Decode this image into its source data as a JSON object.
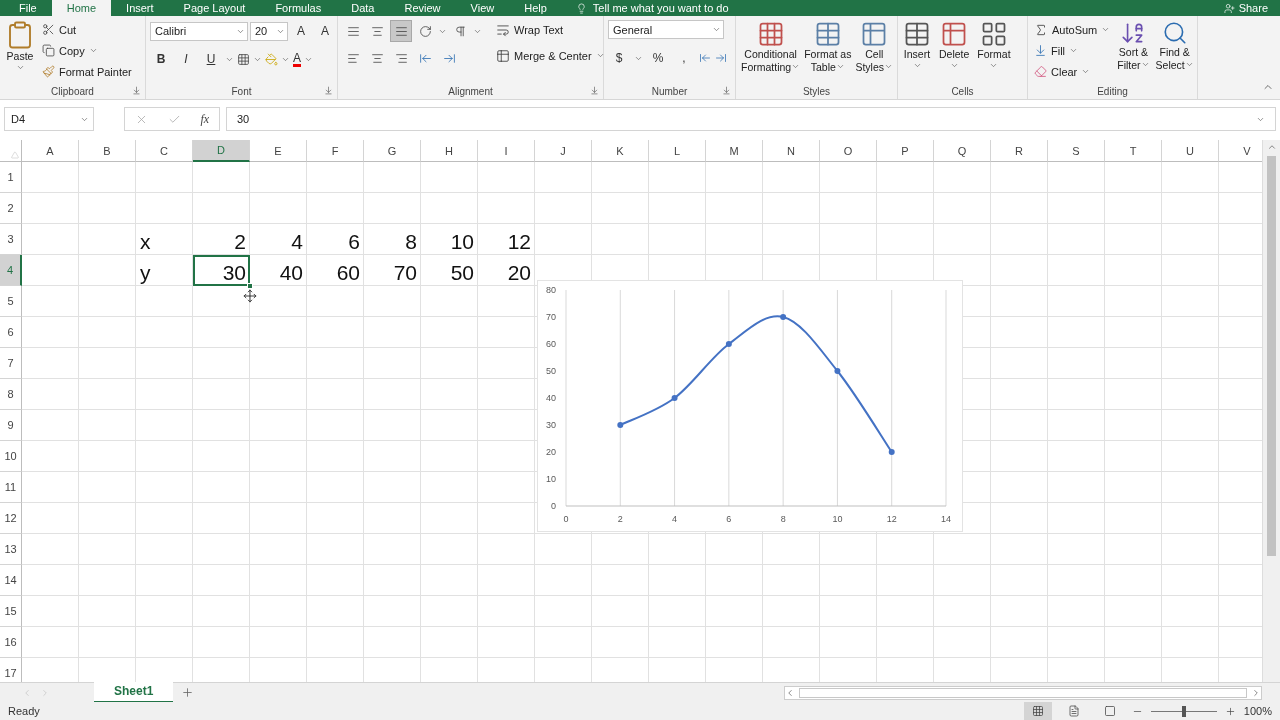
{
  "ribbon_tabs": [
    {
      "label": "File",
      "selected": false
    },
    {
      "label": "Home",
      "selected": true
    },
    {
      "label": "Insert",
      "selected": false
    },
    {
      "label": "Page Layout",
      "selected": false
    },
    {
      "label": "Formulas",
      "selected": false
    },
    {
      "label": "Data",
      "selected": false
    },
    {
      "label": "Review",
      "selected": false
    },
    {
      "label": "View",
      "selected": false
    },
    {
      "label": "Help",
      "selected": false
    }
  ],
  "tell_me": "Tell me what you want to do",
  "share": "Share",
  "clipboard": {
    "label": "Clipboard",
    "paste": "Paste",
    "cut": "Cut",
    "copy": "Copy",
    "format_painter": "Format Painter"
  },
  "font": {
    "label": "Font",
    "name": "Calibri",
    "size": "20",
    "grow": "A",
    "shrink": "A",
    "bold": "B",
    "italic": "I",
    "underline": "U",
    "color_letter": "A"
  },
  "alignment": {
    "label": "Alignment",
    "vertical": [
      {
        "selected": false
      },
      {
        "selected": false
      },
      {
        "selected": true
      }
    ],
    "wrap_text": "Wrap Text",
    "merge_center": "Merge & Center"
  },
  "number": {
    "label": "Number",
    "format": "General",
    "currency": "$",
    "percent": "%",
    "comma": ","
  },
  "styles": {
    "label": "Styles",
    "buttons": [
      {
        "lines": [
          "Conditional",
          "Formatting"
        ]
      },
      {
        "lines": [
          "Format as",
          "Table"
        ]
      },
      {
        "lines": [
          "Cell",
          "Styles"
        ]
      }
    ]
  },
  "cells": {
    "label": "Cells",
    "buttons": [
      "Insert",
      "Delete",
      "Format"
    ]
  },
  "editing": {
    "label": "Editing",
    "autosum": "AutoSum",
    "fill": "Fill",
    "clear": "Clear",
    "sort": [
      "Sort &",
      "Filter"
    ],
    "find": [
      "Find &",
      "Select"
    ]
  },
  "name_box": "D4",
  "function_button": "fx",
  "formula": "30",
  "columns": [
    {
      "label": "A",
      "selected": false
    },
    {
      "label": "B",
      "selected": false
    },
    {
      "label": "C",
      "selected": false
    },
    {
      "label": "D",
      "selected": true
    },
    {
      "label": "E",
      "selected": false
    },
    {
      "label": "F",
      "selected": false
    },
    {
      "label": "G",
      "selected": false
    },
    {
      "label": "H",
      "selected": false
    },
    {
      "label": "I",
      "selected": false
    },
    {
      "label": "J",
      "selected": false
    },
    {
      "label": "K",
      "selected": false
    },
    {
      "label": "L",
      "selected": false
    },
    {
      "label": "M",
      "selected": false
    },
    {
      "label": "N",
      "selected": false
    },
    {
      "label": "O",
      "selected": false
    },
    {
      "label": "P",
      "selected": false
    },
    {
      "label": "Q",
      "selected": false
    },
    {
      "label": "R",
      "selected": false
    },
    {
      "label": "S",
      "selected": false
    },
    {
      "label": "T",
      "selected": false
    },
    {
      "label": "U",
      "selected": false
    },
    {
      "label": "V",
      "selected": false
    }
  ],
  "rows": [
    {
      "header": "1",
      "selected": false
    },
    {
      "header": "2",
      "selected": false
    },
    {
      "header": "3",
      "selected": false,
      "label": "x",
      "values": [
        {
          "text": "2",
          "selected": false
        },
        {
          "text": "4",
          "selected": false
        },
        {
          "text": "6",
          "selected": false
        },
        {
          "text": "8",
          "selected": false
        },
        {
          "text": "10",
          "selected": false
        },
        {
          "text": "12",
          "selected": false
        }
      ]
    },
    {
      "header": "4",
      "selected": true,
      "label": "y",
      "values": [
        {
          "text": "30",
          "selected": true
        },
        {
          "text": "40",
          "selected": false
        },
        {
          "text": "60",
          "selected": false
        },
        {
          "text": "70",
          "selected": false
        },
        {
          "text": "50",
          "selected": false
        },
        {
          "text": "20",
          "selected": false
        }
      ]
    },
    {
      "header": "5",
      "selected": false
    },
    {
      "header": "6",
      "selected": false
    },
    {
      "header": "7",
      "selected": false
    },
    {
      "header": "8",
      "selected": false
    },
    {
      "header": "9",
      "selected": false
    },
    {
      "header": "10",
      "selected": false
    },
    {
      "header": "11",
      "selected": false
    },
    {
      "header": "12",
      "selected": false
    },
    {
      "header": "13",
      "selected": false
    },
    {
      "header": "14",
      "selected": false
    },
    {
      "header": "15",
      "selected": false
    },
    {
      "header": "16",
      "selected": false
    },
    {
      "header": "17",
      "selected": false
    }
  ],
  "chart": {
    "chart_data": {
      "type": "line",
      "x": [
        2,
        4,
        6,
        8,
        10,
        12
      ],
      "series": [
        {
          "color": "#4472c4",
          "marker": "circle",
          "values": [
            30,
            40,
            60,
            70,
            50,
            20
          ]
        }
      ],
      "grid": "vertical",
      "xlim": [
        0,
        14
      ],
      "ylim": [
        0,
        80
      ],
      "xticks": [
        0,
        2,
        4,
        6,
        8,
        10,
        12,
        14
      ],
      "yticks": [
        0,
        10,
        20,
        30,
        40,
        50,
        60,
        70,
        80
      ]
    }
  },
  "sheet_tabs": [
    {
      "label": "Sheet1",
      "selected": true
    }
  ],
  "status": "Ready",
  "zoom": {
    "label": "100%",
    "level": 0.5
  }
}
